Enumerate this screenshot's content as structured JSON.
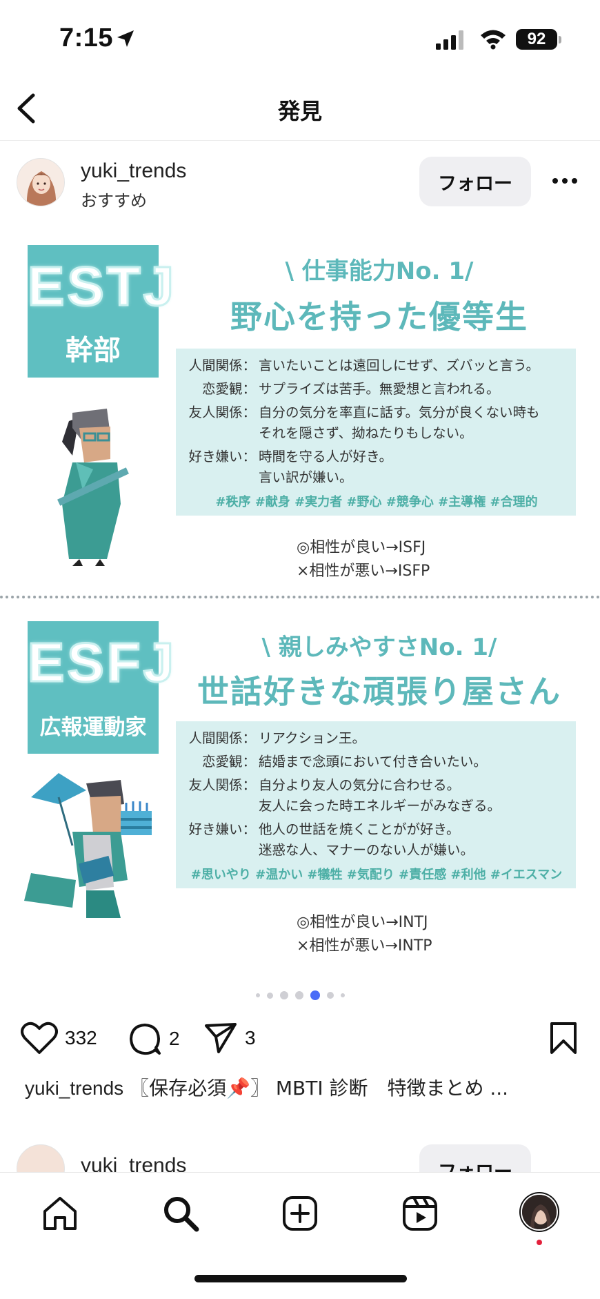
{
  "status": {
    "time": "7:15",
    "battery": "92"
  },
  "nav": {
    "title": "発見"
  },
  "post": {
    "username": "yuki_trends",
    "subtitle": "おすすめ",
    "follow_label": "フォロー"
  },
  "card": {
    "blocks": [
      {
        "code": "ESTJ",
        "role": "幹部",
        "tagline": "\\ 仕事能力No. 1/",
        "headline": "野心を持った優等生",
        "rows": [
          {
            "label": "人間関係：",
            "text": "言いたいことは遠回しにせず、ズバッと言う。"
          },
          {
            "label": "恋愛観：",
            "text": "サプライズは苦手。無愛想と言われる。"
          },
          {
            "label": "友人関係：",
            "text": "自分の気分を率直に話す。気分が良くない時も\nそれを隠さず、拗ねたりもしない。"
          },
          {
            "label": "好き嫌い：",
            "text": "時間を守る人が好き。\n言い訳が嫌い。"
          }
        ],
        "hashtags": "#秩序 #献身 #実力者 #野心 #競争心 #主導権 #合理的",
        "good": "◎相性が良い→ISFJ",
        "bad": "×相性が悪い→ISFP"
      },
      {
        "code": "ESFJ",
        "role": "広報運動家",
        "tagline": "\\ 親しみやすさNo. 1/",
        "headline": "世話好きな頑張り屋さん",
        "rows": [
          {
            "label": "人間関係：",
            "text": "リアクション王。"
          },
          {
            "label": "恋愛観：",
            "text": "結婚まで念頭において付き合いたい。"
          },
          {
            "label": "友人関係：",
            "text": "自分より友人の気分に合わせる。\n友人に会った時エネルギーがみなぎる。"
          },
          {
            "label": "好き嫌い：",
            "text": "他人の世話を焼くことがが好き。\n迷惑な人、マナーのない人が嫌い。"
          }
        ],
        "hashtags": "#思いやり #温かい #犠牲 #気配り #責任感 #利他 #イエスマン",
        "good": "◎相性が良い→INTJ",
        "bad": "×相性が悪い→INTP"
      }
    ]
  },
  "carousel": {
    "count": 7,
    "active_index": 4
  },
  "actions": {
    "likes": "332",
    "comments": "2",
    "shares": "3"
  },
  "caption": {
    "username": "yuki_trends",
    "text": " 〖保存必須📌〗 MBTI 診断　特徴まとめ ..."
  },
  "next_post": {
    "username": "yuki_trends",
    "follow_label": "フォロー"
  },
  "colors": {
    "teal": "#5fbfc1",
    "teal_text": "#5db8ba",
    "info_bg": "#d9f0f0",
    "active_dot": "#4a6cf7"
  }
}
